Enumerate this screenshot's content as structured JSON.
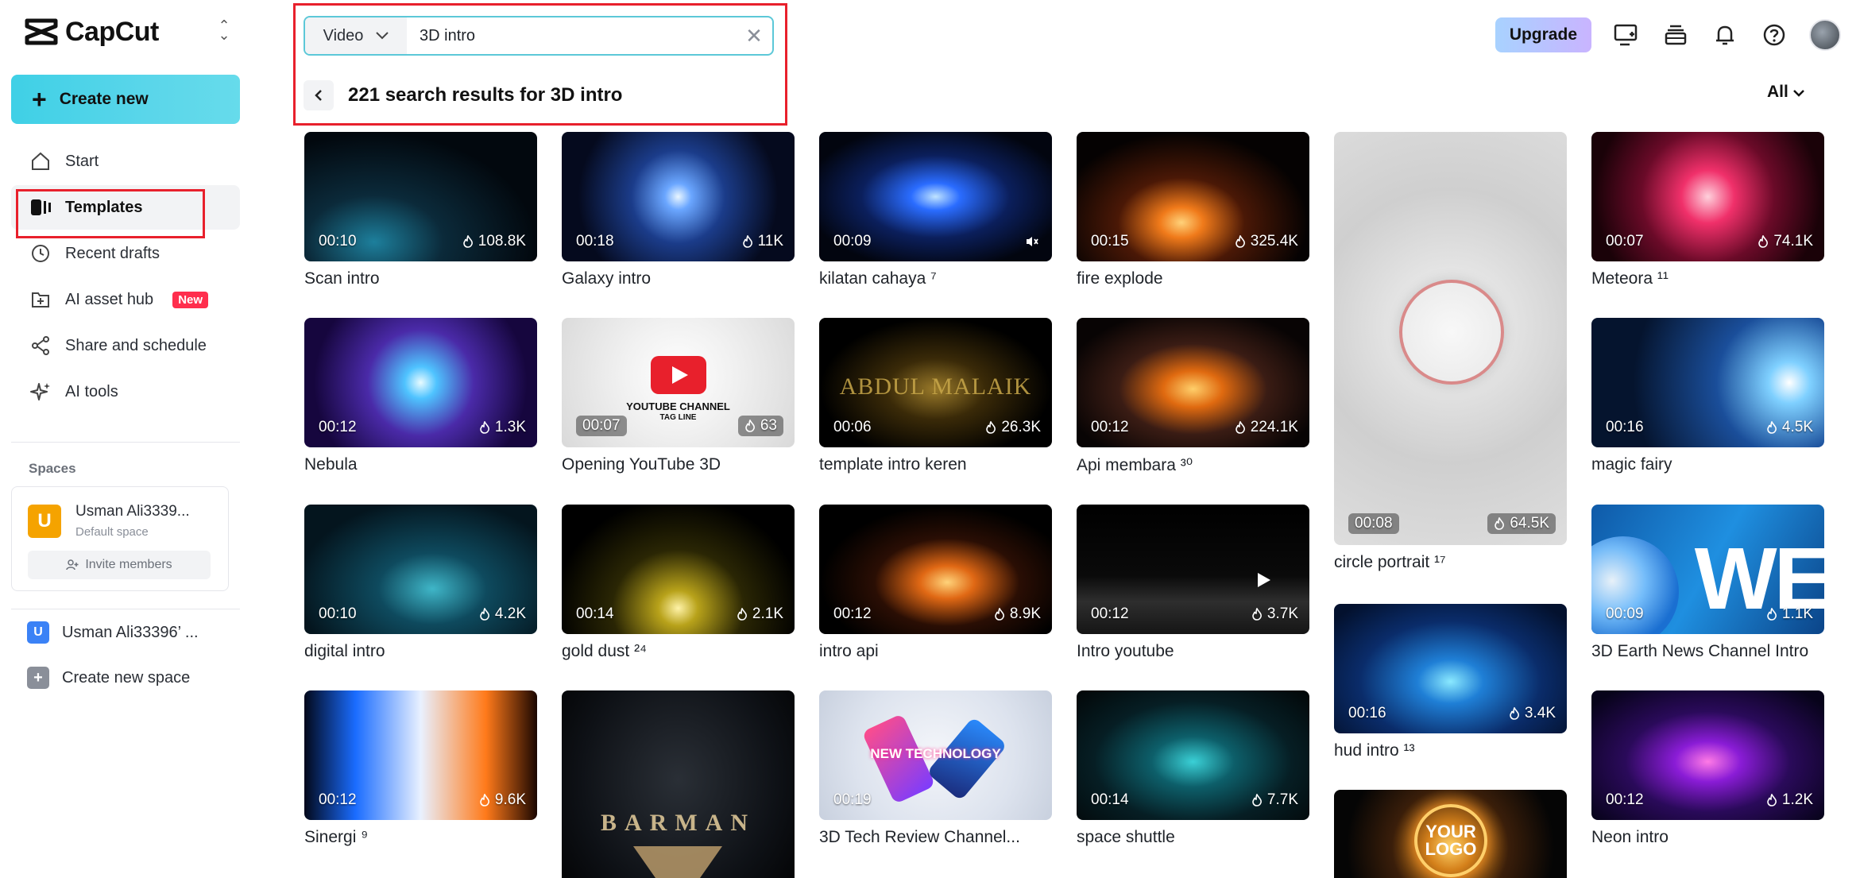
{
  "sidebar": {
    "brand": "CapCut",
    "create_label": "Create new",
    "items": [
      {
        "label": "Start",
        "icon": "home-icon"
      },
      {
        "label": "Templates",
        "icon": "templates-icon"
      },
      {
        "label": "Recent drafts",
        "icon": "clock-icon"
      },
      {
        "label": "AI asset hub",
        "icon": "asset-hub-icon",
        "badge": "New"
      },
      {
        "label": "Share and schedule",
        "icon": "share-icon"
      },
      {
        "label": "AI tools",
        "icon": "sparkle-icon"
      }
    ],
    "spaces_label": "Spaces",
    "space_card": {
      "initial": "U",
      "name": "Usman Ali3339...",
      "sub": "Default space",
      "invite": "Invite members"
    },
    "space_list": [
      {
        "initial": "U",
        "label": "Usman Ali33396’ ..."
      },
      {
        "initial": "+",
        "label": "Create new space"
      }
    ]
  },
  "header": {
    "search_type": "Video",
    "search_value": "3D intro",
    "results_text": "221 search results for 3D intro",
    "filter": "All",
    "upgrade": "Upgrade"
  },
  "colors": {
    "accent": "#5cc8d8",
    "highlight": "#e8202c",
    "new_badge": "#ff2e4d"
  },
  "templates": [
    {
      "title": "Scan intro",
      "duration": "00:10",
      "uses": "108.8K",
      "style": "scan"
    },
    {
      "title": "Galaxy intro",
      "duration": "00:18",
      "uses": "11K",
      "style": "galaxy"
    },
    {
      "title": "kilatan cahaya ⁷",
      "duration": "00:09",
      "uses": "",
      "style": "kilatan",
      "muted": true
    },
    {
      "title": "fire explode",
      "duration": "00:15",
      "uses": "325.4K",
      "style": "fire"
    },
    {
      "title": "circle portrait ¹⁷",
      "duration": "00:08",
      "uses": "64.5K",
      "style": "circle"
    },
    {
      "title": "Meteora ¹¹",
      "duration": "00:07",
      "uses": "74.1K",
      "style": "meteora"
    },
    {
      "title": "Nebula",
      "duration": "00:12",
      "uses": "1.3K",
      "style": "nebula"
    },
    {
      "title": "Opening YouTube 3D",
      "duration": "00:07",
      "uses": "63",
      "style": "youtube",
      "thumb_text": [
        "YOUTUBE CHANNEL",
        "TAG LINE"
      ]
    },
    {
      "title": "template intro keren",
      "duration": "00:06",
      "uses": "26.3K",
      "style": "keren",
      "thumb_text": [
        "ABDUL MALAIK"
      ]
    },
    {
      "title": "Api membara ³⁰",
      "duration": "00:12",
      "uses": "224.1K",
      "style": "api"
    },
    {
      "title": "magic fairy",
      "duration": "00:16",
      "uses": "4.5K",
      "style": "fairy"
    },
    {
      "title": "digital intro",
      "duration": "00:10",
      "uses": "4.2K",
      "style": "digital"
    },
    {
      "title": "gold dust ²⁴",
      "duration": "00:14",
      "uses": "2.1K",
      "style": "gold"
    },
    {
      "title": "intro api",
      "duration": "00:12",
      "uses": "8.9K",
      "style": "introapi"
    },
    {
      "title": "Intro youtube",
      "duration": "00:12",
      "uses": "3.7K",
      "style": "introyt"
    },
    {
      "title": "3D Earth News Channel Intro",
      "duration": "00:09",
      "uses": "1.1K",
      "style": "earth",
      "thumb_text": [
        "WE"
      ]
    },
    {
      "title": "hud intro ¹³",
      "duration": "00:16",
      "uses": "3.4K",
      "style": "hud"
    },
    {
      "title": "Sinergi ⁹",
      "duration": "00:12",
      "uses": "9.6K",
      "style": "sinergi"
    },
    {
      "title": "",
      "duration": "",
      "uses": "",
      "style": "barman",
      "thumb_text": [
        "BARMAN"
      ]
    },
    {
      "title": "3D Tech Review Channel...",
      "duration": "00:19",
      "uses": "",
      "style": "tech",
      "thumb_text": [
        "NEW TECHNOLOGY"
      ]
    },
    {
      "title": "space shuttle",
      "duration": "00:14",
      "uses": "7.7K",
      "style": "shuttle"
    },
    {
      "title": "",
      "duration": "",
      "uses": "",
      "style": "logo",
      "thumb_text": [
        "YOUR",
        "LOGO"
      ]
    },
    {
      "title": "Neon intro",
      "duration": "00:12",
      "uses": "1.2K",
      "style": "neon"
    }
  ]
}
